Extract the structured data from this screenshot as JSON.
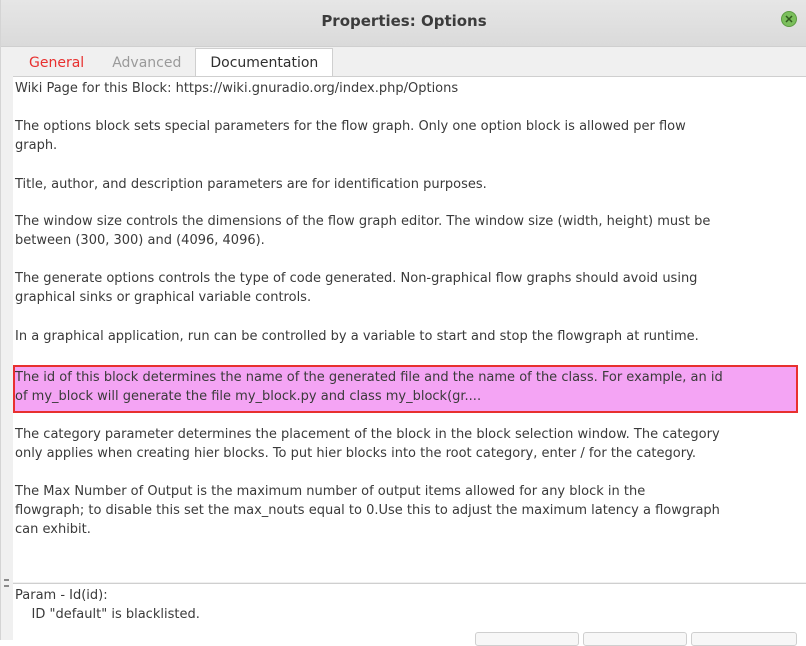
{
  "window": {
    "title": "Properties: Options"
  },
  "tabs": [
    {
      "label": "General",
      "color": "#e8302f"
    },
    {
      "label": "Advanced",
      "color": "#9a9a9a"
    },
    {
      "label": "Documentation",
      "active": true
    }
  ],
  "documentation": {
    "wiki": "Wiki Page for this Block: https://wiki.gnuradio.org/index.php/Options",
    "p1": "The options block sets special parameters for the flow graph. Only one option block is allowed per flow\ngraph.",
    "p2": "Title, author, and description parameters are for identification purposes.",
    "p3": "The window size controls the dimensions of the flow graph editor. The window size (width, height) must be\nbetween (300, 300) and (4096, 4096).",
    "p4": "The generate options controls the type of code generated. Non-graphical flow graphs should avoid using\ngraphical sinks or graphical variable controls.",
    "p5": "In a graphical application, run can be controlled by a variable to start and stop the flowgraph at runtime.",
    "p6": "The id of this block determines the name of the generated file and the name of the class. For example, an id\nof my_block will generate the file my_block.py and class my_block(gr....",
    "p7": "The category parameter determines the placement of the block in the block selection window. The category\nonly applies when creating hier blocks. To put hier blocks into the root category, enter / for the category.",
    "p8": "The Max Number of Output is the maximum number of output items allowed for any block in the\nflowgraph; to disable this set the max_nouts equal to 0.Use this to adjust the maximum latency a flowgraph\ncan exhibit.",
    "highlight_color": "#f4a4f4",
    "highlight_border": "#e8302f"
  },
  "param": {
    "title": "Param - Id(id):",
    "message": "    ID \"default\" is blacklisted."
  }
}
